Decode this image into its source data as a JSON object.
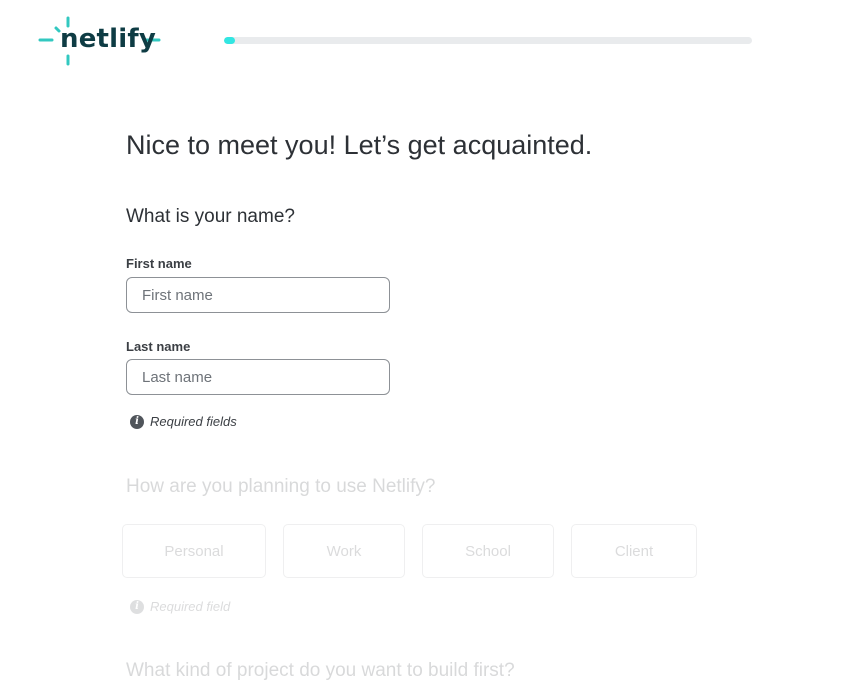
{
  "brand": {
    "name": "netlify",
    "logo_color": "#0e3c44",
    "spark_color": "#32c8c0"
  },
  "progress": {
    "value": 0.02,
    "fill_color": "#32e6e2"
  },
  "page": {
    "title": "Nice to meet you! Let’s get acquainted."
  },
  "name_section": {
    "heading": "What is your name?",
    "first_name": {
      "label": "First name",
      "placeholder": "First name",
      "value": ""
    },
    "last_name": {
      "label": "Last name",
      "placeholder": "Last name",
      "value": ""
    },
    "required_note": "Required fields"
  },
  "usage_section": {
    "heading": "How are you planning to use Netlify?",
    "options": [
      "Personal",
      "Work",
      "School",
      "Client"
    ],
    "required_note": "Required field"
  },
  "project_section": {
    "heading": "What kind of project do you want to build first?"
  }
}
